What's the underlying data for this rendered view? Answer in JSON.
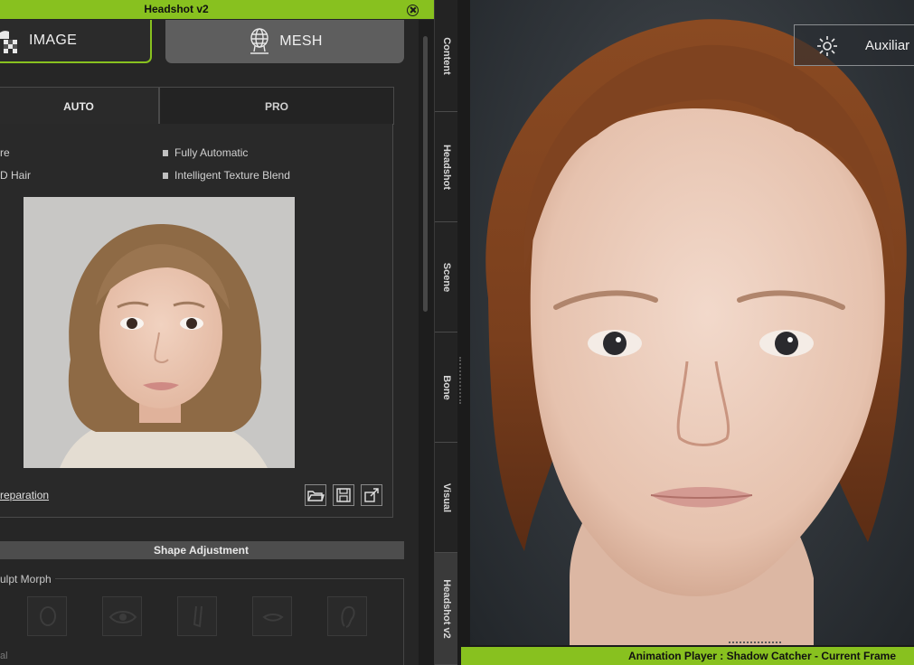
{
  "panel": {
    "title": "Headshot v2",
    "close_icon": "close-circle-icon"
  },
  "modes": {
    "image_label": "IMAGE",
    "mesh_label": "MESH"
  },
  "tabs": {
    "auto": "AUTO",
    "pro": "PRO"
  },
  "options": {
    "left_1": "re",
    "left_2": "D Hair",
    "right_1": "Fully Automatic",
    "right_2": "Intelligent Texture Blend"
  },
  "photo_prep_link": "reparation",
  "shape_section": {
    "title": "Shape Adjustment",
    "sculpt_label": "ulpt Morph",
    "bottom_label": "al"
  },
  "vertical_tabs": [
    "Content",
    "Headshot",
    "Scene",
    "Bone",
    "Visual",
    "Headshot v2"
  ],
  "viewport": {
    "aux_label": "Auxiliar"
  },
  "status": {
    "text": "Animation Player : Shadow Catcher - Current Frame"
  },
  "colors": {
    "accent": "#88c11f",
    "panel_bg": "#262626"
  }
}
